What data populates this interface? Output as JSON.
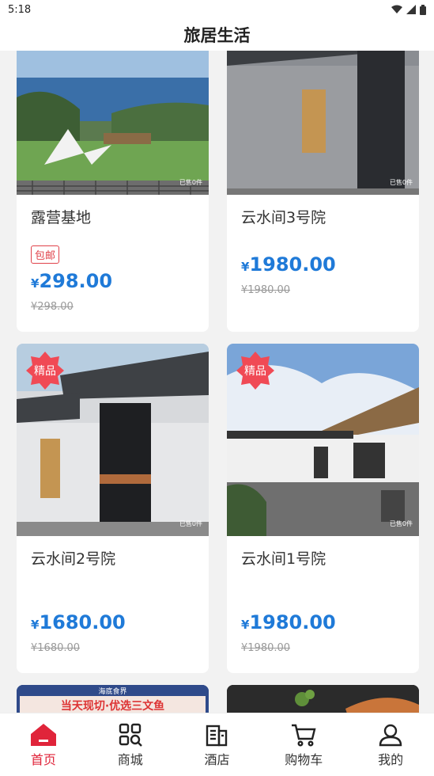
{
  "status": {
    "time": "5:18"
  },
  "header": {
    "title": "旅居生活"
  },
  "products": [
    {
      "title": "露营基地",
      "tag": "包邮",
      "currency": "¥",
      "price": "298.00",
      "orig": "¥298.00",
      "sold": "已售0件"
    },
    {
      "title": "云水间3号院",
      "currency": "¥",
      "price": "1980.00",
      "orig": "¥1980.00",
      "sold": "已售0件"
    },
    {
      "title": "云水间2号院",
      "badge": "精品",
      "currency": "¥",
      "price": "1680.00",
      "orig": "¥1680.00",
      "sold": "已售0件"
    },
    {
      "title": "云水间1号院",
      "badge": "精品",
      "currency": "¥",
      "price": "1980.00",
      "orig": "¥1980.00",
      "sold": "已售0件"
    }
  ],
  "partial_card": {
    "banner_text": "海底食界",
    "headline": "当天现切·优选三文鱼"
  },
  "tabs": [
    {
      "label": "首页",
      "icon": "home-icon",
      "active": true
    },
    {
      "label": "商城",
      "icon": "grid-search-icon",
      "active": false
    },
    {
      "label": "酒店",
      "icon": "hotel-building-icon",
      "active": false
    },
    {
      "label": "购物车",
      "icon": "cart-icon",
      "active": false
    },
    {
      "label": "我的",
      "icon": "profile-icon",
      "active": false
    }
  ],
  "colors": {
    "accent_red": "#e0243a",
    "price_blue": "#1f7ad8",
    "badge_red": "#f04a55"
  }
}
